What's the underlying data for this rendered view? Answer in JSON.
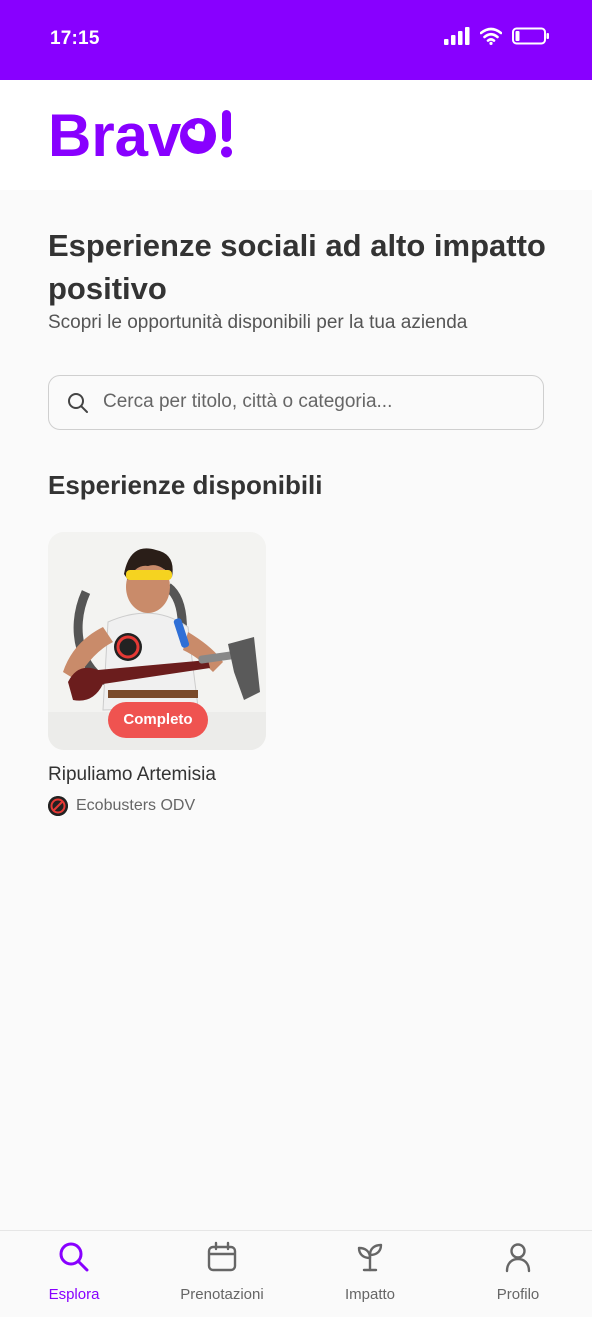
{
  "status_bar": {
    "time": "17:15"
  },
  "brand": {
    "name": "Bravo!",
    "color": "#8800ff"
  },
  "page": {
    "title": "Esperienze sociali ad alto impatto positivo",
    "subtitle": "Scopri le opportunità disponibili per la tua azienda"
  },
  "search": {
    "placeholder": "Cerca per titolo, città o categoria...",
    "value": ""
  },
  "section": {
    "title": "Esperienze disponibili"
  },
  "experiences": [
    {
      "title": "Ripuliamo Artemisia",
      "organization": "Ecobusters ODV",
      "badge": "Completo",
      "badge_color": "#ef5350"
    }
  ],
  "tabs": [
    {
      "label": "Esplora",
      "icon": "search-icon",
      "active": true
    },
    {
      "label": "Prenotazioni",
      "icon": "calendar-icon",
      "active": false
    },
    {
      "label": "Impatto",
      "icon": "sprout-icon",
      "active": false
    },
    {
      "label": "Profilo",
      "icon": "user-icon",
      "active": false
    }
  ],
  "colors": {
    "accent": "#8800ff",
    "background": "#fafafa",
    "badge": "#ef5350"
  }
}
